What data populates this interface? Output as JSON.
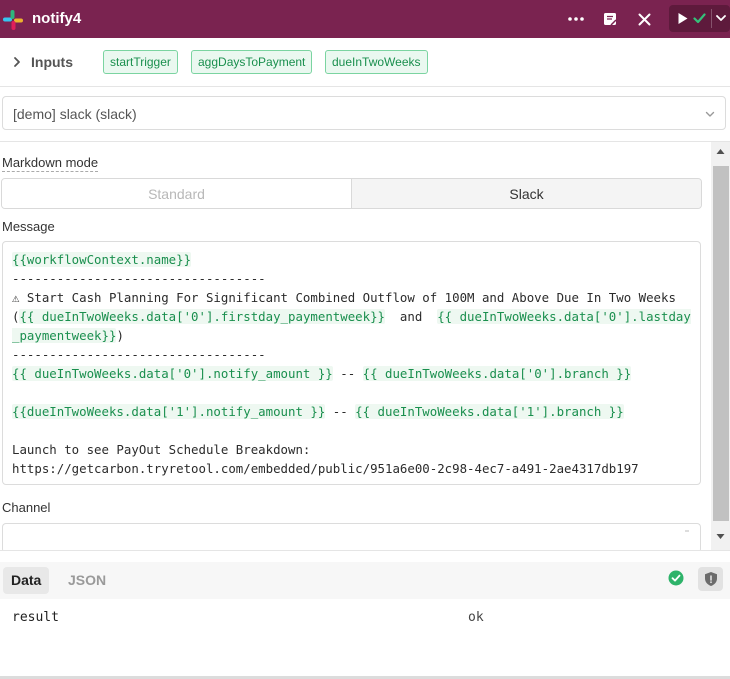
{
  "header": {
    "title": "notify4",
    "accent_color": "#7a2350",
    "icons": [
      "slack-logo-icon",
      "more-icon",
      "edit-note-icon",
      "close-icon",
      "play-icon",
      "check-icon",
      "chevron-down-icon"
    ]
  },
  "inputs": {
    "label": "Inputs",
    "chips": [
      "startTrigger",
      "aggDaysToPayment",
      "dueInTwoWeeks"
    ]
  },
  "resource": {
    "selected": "[demo] slack (slack)"
  },
  "markdown_mode": {
    "label": "Markdown mode",
    "options": [
      "Standard",
      "Slack"
    ],
    "selected": "Slack"
  },
  "message": {
    "label": "Message",
    "lines": {
      "l1_tpl": "{{workflowContext.name}}",
      "l2": "----------------------------------",
      "l3_text": "⚠ Start Cash Planning For Significant Combined Outflow of 100M and Above Due In Two Weeks (",
      "l3_tpl1": "{{ dueInTwoWeeks.data['0'].firstday_paymentweek}}",
      "l3_and": "  and  ",
      "l3_tpl2": "{{ dueInTwoWeeks.data['0'].lastday_paymentweek}}",
      "l3_close": ")",
      "l4": "----------------------------------",
      "l5_tpl1": "{{ dueInTwoWeeks.data['0'].notify_amount }}",
      "l5_sep": " -- ",
      "l5_tpl2": "{{ dueInTwoWeeks.data['0'].branch }}",
      "l6_tpl1": "{{dueInTwoWeeks.data['1'].notify_amount }}",
      "l6_sep": " -- ",
      "l6_tpl2": "{{ dueInTwoWeeks.data['1'].branch }}",
      "l7": "Launch to see PayOut Schedule Breakdown:",
      "l8": "https://getcarbon.tryretool.com/embedded/public/951a6e00-2c98-4ec7-a491-2ae4317db197"
    }
  },
  "channel": {
    "label": "Channel",
    "value": ""
  },
  "result_panel": {
    "tabs": [
      "Data",
      "JSON"
    ],
    "active_tab": "Data",
    "status_color": "#2eb36a",
    "rows": [
      {
        "key": "result",
        "value": "ok"
      }
    ]
  }
}
